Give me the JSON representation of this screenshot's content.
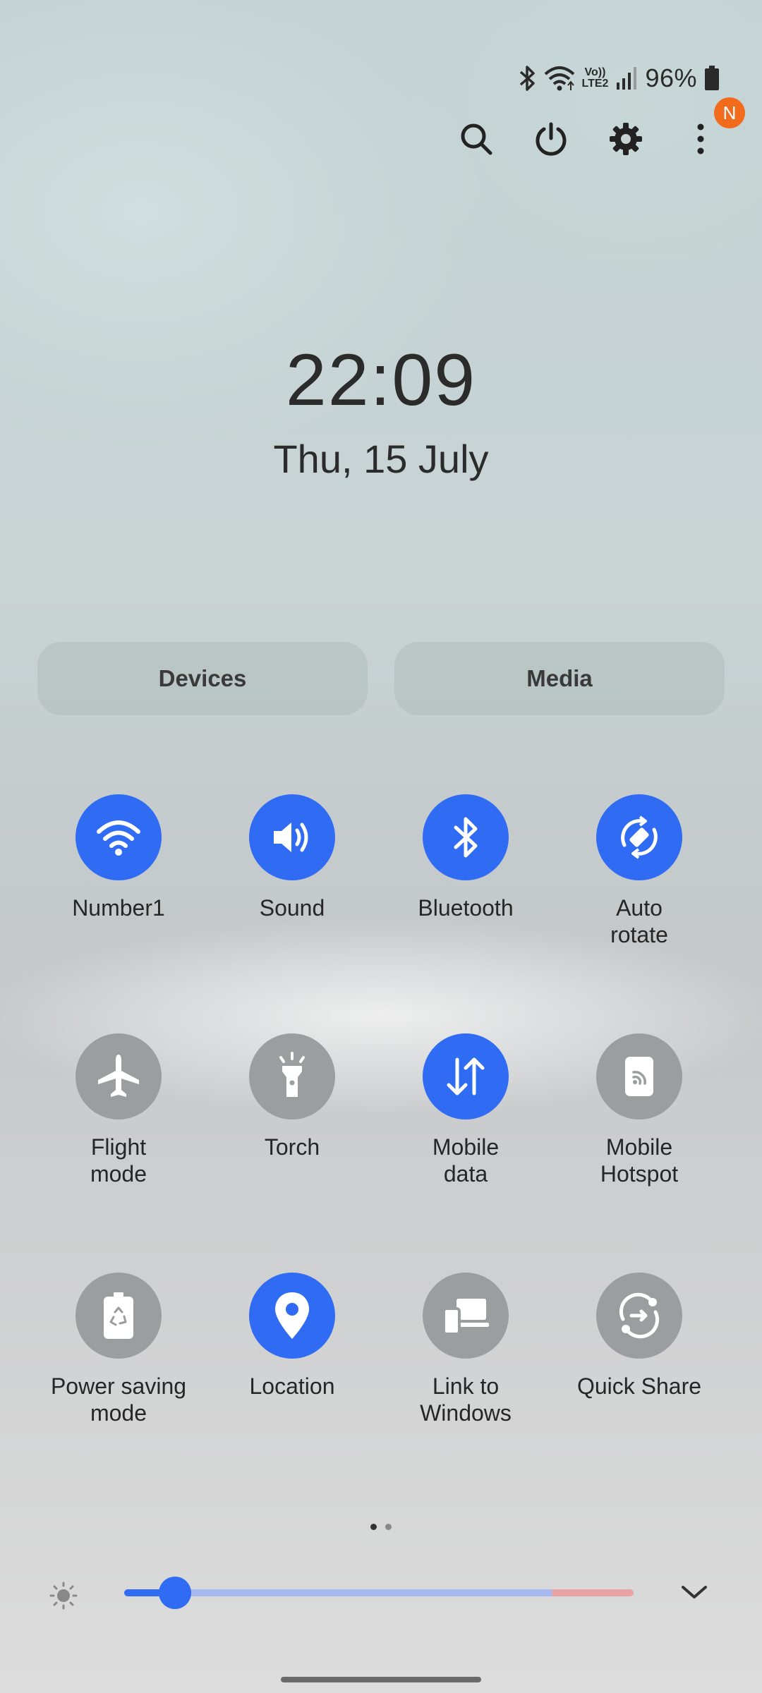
{
  "status_bar": {
    "battery_percent": "96%",
    "network_label_top": "Vo))",
    "network_label_bottom": "LTE2"
  },
  "top_actions": {
    "notification_badge": "N"
  },
  "clock": {
    "time": "22:09",
    "date": "Thu, 15 July"
  },
  "buttons": {
    "devices": "Devices",
    "media": "Media"
  },
  "tiles": [
    {
      "label": "Number1",
      "state": "on",
      "icon": "wifi-icon"
    },
    {
      "label": "Sound",
      "state": "on",
      "icon": "sound-icon"
    },
    {
      "label": "Bluetooth",
      "state": "on",
      "icon": "bluetooth-icon"
    },
    {
      "label": "Auto\nrotate",
      "state": "on",
      "icon": "auto-rotate-icon"
    },
    {
      "label": "Flight\nmode",
      "state": "off",
      "icon": "airplane-icon"
    },
    {
      "label": "Torch",
      "state": "off",
      "icon": "torch-icon"
    },
    {
      "label": "Mobile\ndata",
      "state": "on",
      "icon": "mobile-data-icon"
    },
    {
      "label": "Mobile\nHotspot",
      "state": "off",
      "icon": "hotspot-icon"
    },
    {
      "label": "Power saving\nmode",
      "state": "off",
      "icon": "power-saving-icon"
    },
    {
      "label": "Location",
      "state": "on",
      "icon": "location-icon"
    },
    {
      "label": "Link to\nWindows",
      "state": "off",
      "icon": "link-to-windows-icon"
    },
    {
      "label": "Quick Share",
      "state": "off",
      "icon": "quick-share-icon"
    }
  ],
  "pages": {
    "count": 2,
    "current": 1
  },
  "brightness": {
    "level": 0.1
  },
  "colors": {
    "accent": "#2f6bf3",
    "tile_off": "#9b9d9f",
    "badge": "#f26a1b"
  }
}
